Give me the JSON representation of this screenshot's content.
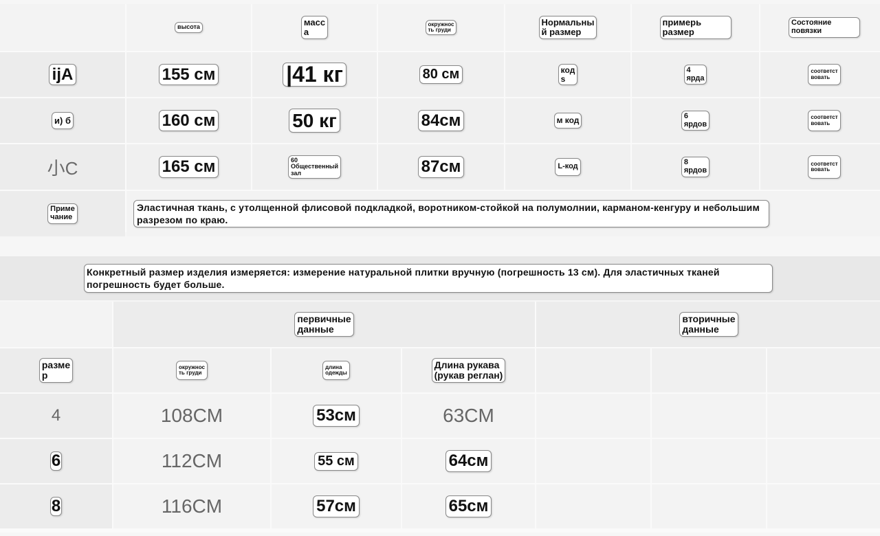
{
  "size_table": {
    "headers": {
      "height": "высота",
      "weight": "масс\nа",
      "chest": "окружнос\nть груди",
      "normal_size": "Нормальны\nй размер",
      "fit_size": "примерь\nразмер",
      "bandage_state": "Состояние\nповязки"
    },
    "rows": [
      {
        "label": "ijA",
        "height": "155 см",
        "weight": "|41 кг",
        "chest": "80 см",
        "code": "код\ns",
        "yards": "4\nярда",
        "state": "соответст\nвовать"
      },
      {
        "label": "и) б",
        "height": "160 см",
        "weight": "50 кг",
        "chest": "84см",
        "code": "м код",
        "yards": "6\nярдов",
        "state": "соответст\nвовать"
      },
      {
        "label": "小C",
        "height": "165 см",
        "weight": "60\nОбщественный\nзал",
        "chest": "87см",
        "code": "L-код",
        "yards": "8\nярдов",
        "state": "соответст\nвовать"
      }
    ],
    "note_label": "Приме\nчание",
    "note_text": "Эластичная ткань, с утолщенной флисовой подкладкой, воротником-стойкой на полумолнии, карманом-кенгуру и небольшим разрезом по краю."
  },
  "banner_text": "Конкретный размер изделия измеряется: измерение натуральной плитки вручную (погрешность 13 см). Для эластичных тканей погрешность будет больше.",
  "measure_table": {
    "group_primary": "первичные\nданные",
    "group_secondary": "вторичные\nданные",
    "col_size": "разме\nр",
    "col_chest": "окружнос\nть груди",
    "col_length": "длина\nодежды",
    "col_sleeve": "Длина рукава\n(рукав реглан)",
    "rows": [
      {
        "size": "4",
        "chest": "108CM",
        "length": "53см",
        "sleeve": "63CM"
      },
      {
        "size": "6",
        "chest": "112CM",
        "length": "55 см",
        "sleeve": "64см"
      },
      {
        "size": "8",
        "chest": "116CM",
        "length": "57см",
        "sleeve": "65см"
      }
    ]
  }
}
